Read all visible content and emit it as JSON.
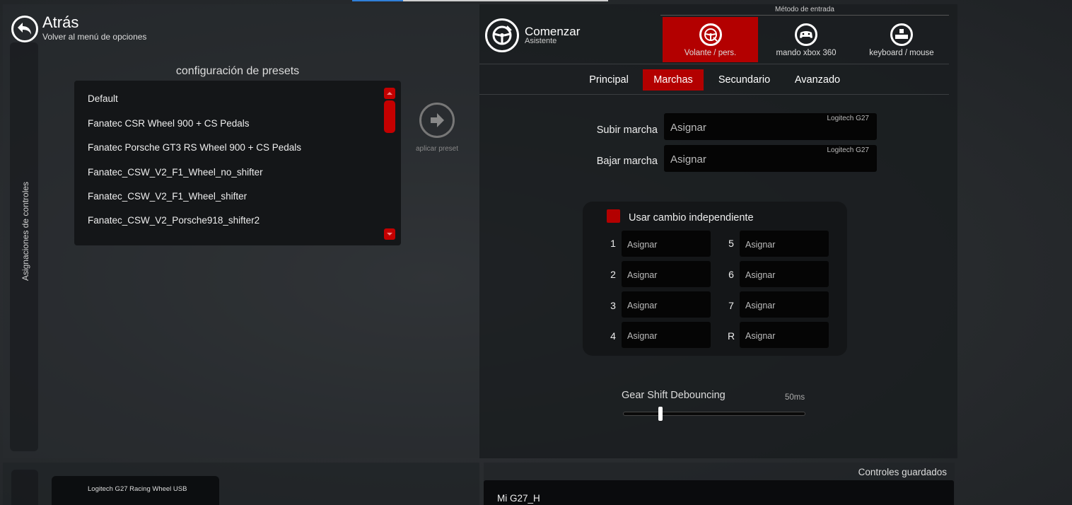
{
  "back": {
    "title": "Atrás",
    "subtitle": "Volver al menú de opciones"
  },
  "sidebar": {
    "label": "Asignaciones de controles"
  },
  "presets": {
    "title": "configuración de presets",
    "items": [
      "Default",
      "Fanatec CSR Wheel 900 + CS Pedals",
      "Fanatec Porsche GT3 RS Wheel 900 + CS Pedals",
      "Fanatec_CSW_V2_F1_Wheel_no_shifter",
      "Fanatec_CSW_V2_F1_Wheel_shifter",
      "Fanatec_CSW_V2_Porsche918_shifter2"
    ],
    "apply_label": "aplicar preset"
  },
  "start": {
    "title": "Comenzar",
    "subtitle": "Asistente"
  },
  "input_method": {
    "title": "Método de entrada",
    "options": [
      {
        "label": "Volante / pers.",
        "icon": "wheel-custom-icon",
        "active": true
      },
      {
        "label": "mando xbox 360",
        "icon": "gamepad-icon",
        "active": false
      },
      {
        "label": "keyboard / mouse",
        "icon": "keyboard-icon",
        "active": false
      }
    ]
  },
  "tabs": [
    {
      "label": "Principal",
      "active": false
    },
    {
      "label": "Marchas",
      "active": true
    },
    {
      "label": "Secundario",
      "active": false
    },
    {
      "label": "Avanzado",
      "active": false
    }
  ],
  "gears": {
    "shift_up": {
      "label": "Subir marcha",
      "value": "Asignar",
      "device": "Logitech G27"
    },
    "shift_down": {
      "label": "Bajar marcha",
      "value": "Asignar",
      "device": "Logitech G27"
    }
  },
  "independent_shifter": {
    "label": "Usar cambio independiente",
    "checked": true,
    "slots": [
      {
        "gear": "1",
        "value": "Asignar"
      },
      {
        "gear": "2",
        "value": "Asignar"
      },
      {
        "gear": "3",
        "value": "Asignar"
      },
      {
        "gear": "4",
        "value": "Asignar"
      },
      {
        "gear": "5",
        "value": "Asignar"
      },
      {
        "gear": "6",
        "value": "Asignar"
      },
      {
        "gear": "7",
        "value": "Asignar"
      },
      {
        "gear": "R",
        "value": "Asignar"
      }
    ]
  },
  "debounce": {
    "label": "Gear Shift Debouncing",
    "value": "50ms"
  },
  "device": {
    "name": "Logitech G27 Racing Wheel USB"
  },
  "saved_controls": {
    "title": "Controles guardados",
    "items": [
      "Mi G27_H"
    ]
  },
  "colors": {
    "accent": "#b30000",
    "field_bg": "#050505"
  }
}
